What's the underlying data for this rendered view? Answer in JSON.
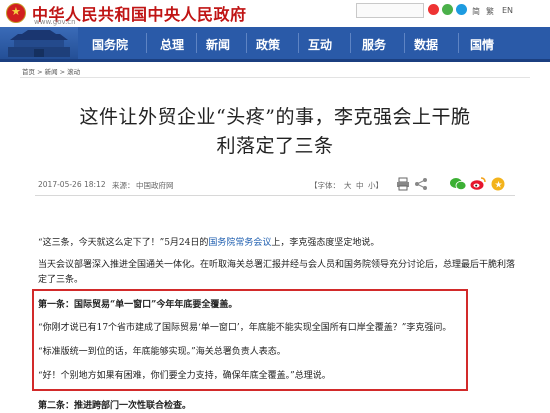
{
  "site": {
    "title": "中华人民共和国中央人民政府",
    "url": "www.gov.cn"
  },
  "utility": {
    "lang_en": "EN",
    "lang_tw": "简",
    "lang_zh": "繁"
  },
  "nav": {
    "items": [
      "国务院",
      "总理",
      "新闻",
      "政策",
      "互动",
      "服务",
      "数据",
      "国情"
    ]
  },
  "breadcrumb": {
    "text": "首页 > 新闻 > 滚动"
  },
  "article": {
    "title_line1": "这件让外贸企业“头疼”的事，李克强会上干脆",
    "title_line2": "利落定了三条",
    "date": "2017-05-26 18:12",
    "source_label": "来源：",
    "source": "中国政府网",
    "font_label": "【字体：",
    "font_large": "大",
    "font_mid": "中",
    "font_small": "小】",
    "p1_a": "“这三条，今天就这么定下了！”5月24日的",
    "p1_link": "国务院常务会议",
    "p1_b": "上，李克强态度坚定地说。",
    "p2_line1": "当天会议部署深入推进全国通关一体化。在听取海关总署汇报并经与会人员和国务院领导充分讨论后，总理最后干脆利落",
    "p2_line2": "定了三条。",
    "box_p1": "第一条：国际贸易“单一窗口”今年年底要全覆盖。",
    "box_p2": "“你刚才说已有17个省市建成了国际贸易‘单一窗口’，年底能不能实现全国所有口岸全覆盖？”李克强问。",
    "box_p3": "“标准版统一到位的话，年底能够实现。”海关总署负责人表态。",
    "box_p4": "“好！个别地方如果有困难，你们要全力支持，确保年底全覆盖。”总理说。",
    "p_last": "第二条：推进跨部门一次性联合检查。"
  },
  "colors": {
    "brand_red": "#c01515",
    "nav_blue": "#2a5aa8",
    "link_blue": "#1f5fb0",
    "highlight_red": "#d22a2a"
  },
  "icons": [
    "emblem-icon",
    "weibo-icon",
    "wechat-icon",
    "print-icon",
    "share-icon"
  ]
}
